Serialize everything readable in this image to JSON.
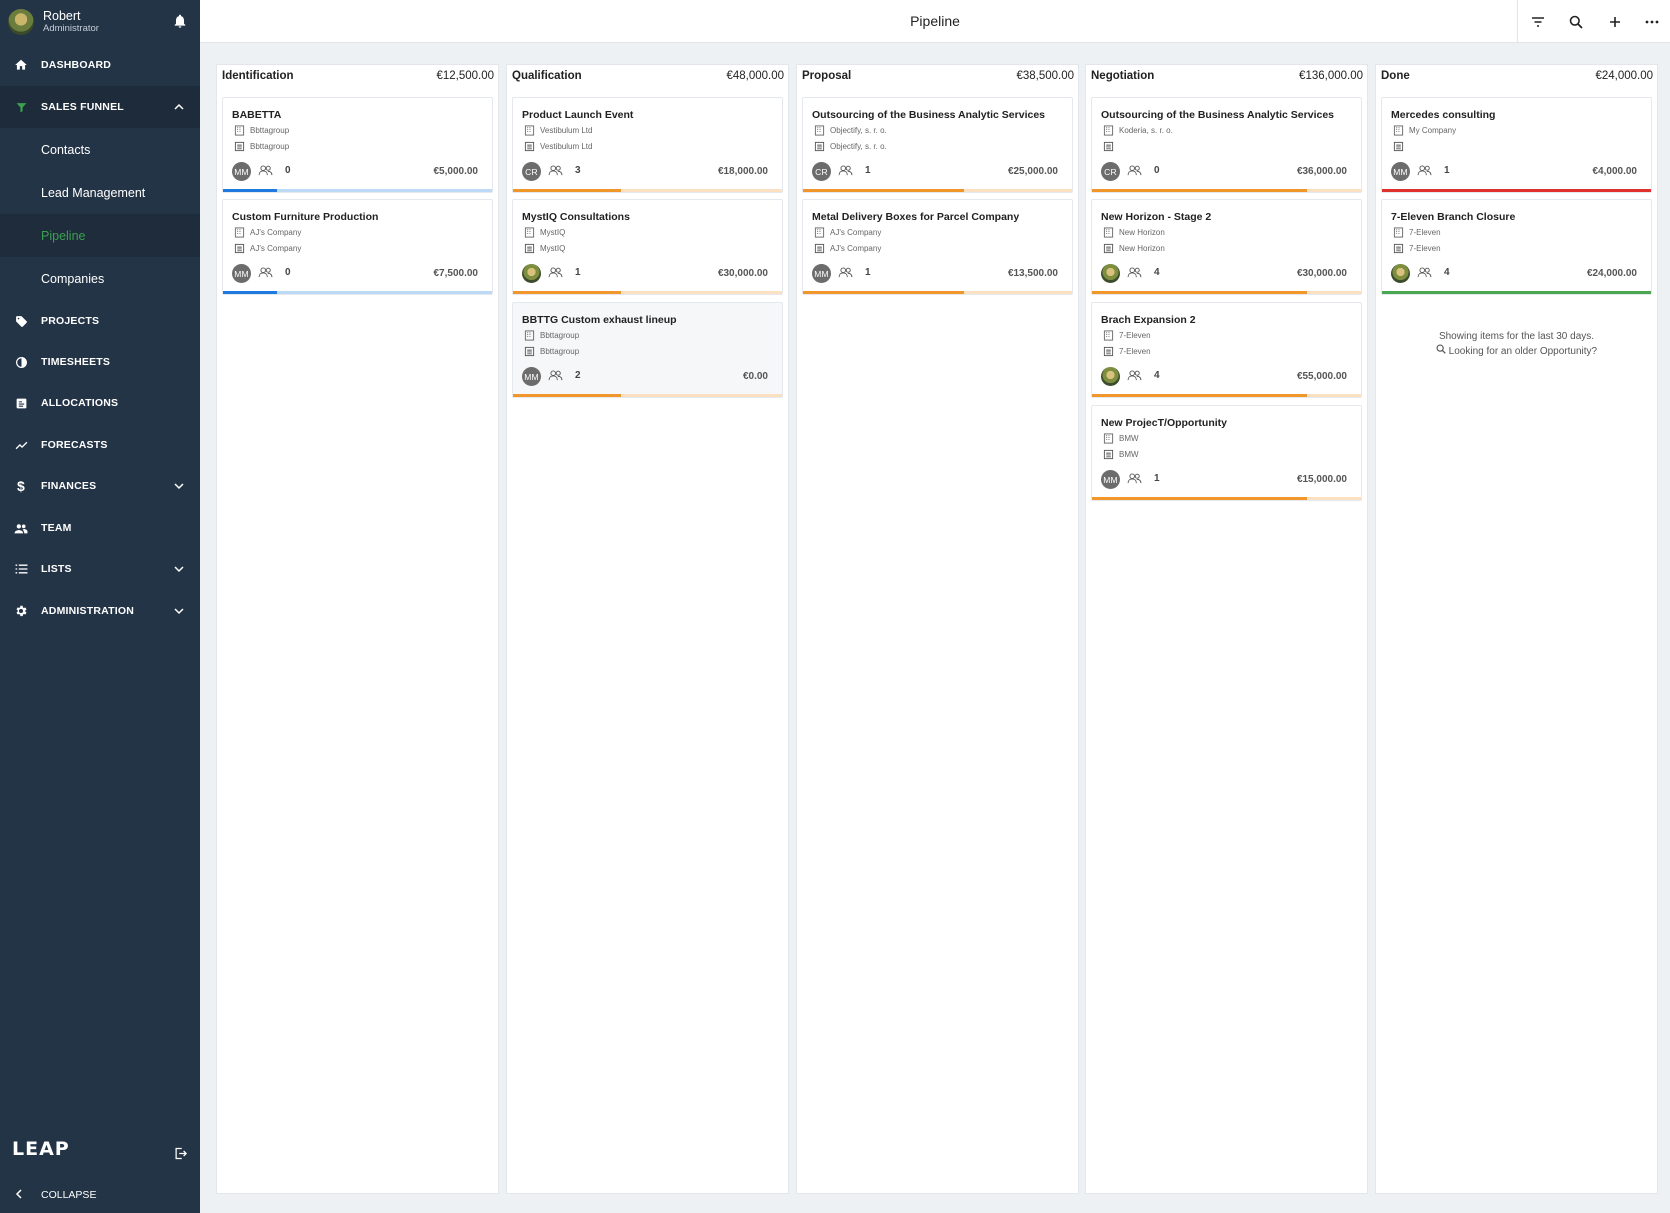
{
  "user": {
    "name": "Robert",
    "role": "Administrator"
  },
  "nav": {
    "dashboard": "DASHBOARD",
    "sales_funnel": "SALES FUNNEL",
    "sub": [
      "Contacts",
      "Lead Management",
      "Pipeline",
      "Companies"
    ],
    "projects": "PROJECTS",
    "timesheets": "TIMESHEETS",
    "allocations": "ALLOCATIONS",
    "forecasts": "FORECASTS",
    "finances": "FINANCES",
    "team": "TEAM",
    "lists": "LISTS",
    "administration": "ADMINISTRATION",
    "collapse": "COLLAPSE",
    "logo": "LEAP"
  },
  "page": {
    "title": "Pipeline"
  },
  "colors": {
    "blue": "#1f7ae0",
    "blue_light": "#bcd9f5",
    "orange": "#f0962a",
    "orange_light": "#fbe0c2",
    "red": "#e0322c",
    "green": "#49a651",
    "sidebar": "#243447",
    "accent": "#3aa14f"
  },
  "columns": [
    {
      "name": "Identification",
      "total": "€12,500.00",
      "cards": [
        {
          "title": "BABETTA",
          "company": "Bbttagroup",
          "account": "Bbttagroup",
          "avatar": "MM",
          "people": "0",
          "amount": "€5,000.00",
          "bar_color": "blue",
          "progress": 0.2
        },
        {
          "title": "Custom Furniture Production",
          "company": "AJ's Company",
          "account": "AJ's Company",
          "avatar": "MM",
          "people": "0",
          "amount": "€7,500.00",
          "bar_color": "blue",
          "progress": 0.2
        }
      ]
    },
    {
      "name": "Qualification",
      "total": "€48,000.00",
      "cards": [
        {
          "title": "Product Launch Event",
          "company": "Vestibulum Ltd",
          "account": "Vestibulum Ltd",
          "avatar": "CR",
          "people": "3",
          "amount": "€18,000.00",
          "bar_color": "orange",
          "progress": 0.4
        },
        {
          "title": "MystIQ Consultations",
          "company": "MystIQ",
          "account": "MystIQ",
          "avatar": "",
          "photo": true,
          "people": "1",
          "amount": "€30,000.00",
          "bar_color": "orange",
          "progress": 0.4
        },
        {
          "title": "BBTTG Custom exhaust lineup",
          "company": "Bbttagroup",
          "account": "Bbttagroup",
          "avatar": "MM",
          "people": "2",
          "amount": "€0.00",
          "bar_color": "orange",
          "progress": 0.4,
          "hover": true
        }
      ]
    },
    {
      "name": "Proposal",
      "total": "€38,500.00",
      "cards": [
        {
          "title": "Outsourcing of the Business Analytic Services",
          "company": "Objectify, s. r. o.",
          "account": "Objectify, s. r. o.",
          "avatar": "CR",
          "people": "1",
          "amount": "€25,000.00",
          "bar_color": "orange",
          "progress": 0.6
        },
        {
          "title": "Metal Delivery Boxes for Parcel Company",
          "company": "AJ's Company",
          "account": "AJ's Company",
          "avatar": "MM",
          "people": "1",
          "amount": "€13,500.00",
          "bar_color": "orange",
          "progress": 0.6
        }
      ]
    },
    {
      "name": "Negotiation",
      "total": "€136,000.00",
      "cards": [
        {
          "title": "Outsourcing of the Business Analytic Services",
          "company": "Koderia, s. r. o.",
          "account": "",
          "avatar": "CR",
          "people": "0",
          "amount": "€36,000.00",
          "bar_color": "orange",
          "progress": 0.8
        },
        {
          "title": "New Horizon - Stage 2",
          "company": "New Horizon",
          "account": "New Horizon",
          "avatar": "",
          "photo": true,
          "people": "4",
          "amount": "€30,000.00",
          "bar_color": "orange",
          "progress": 0.8
        },
        {
          "title": "Brach Expansion 2",
          "company": "7-Eleven",
          "account": "7-Eleven",
          "avatar": "",
          "photo": true,
          "people": "4",
          "amount": "€55,000.00",
          "bar_color": "orange",
          "progress": 0.8
        },
        {
          "title": "New ProjecT/Opportunity",
          "company": "BMW",
          "account": "BMW",
          "avatar": "MM",
          "people": "1",
          "amount": "€15,000.00",
          "bar_color": "orange",
          "progress": 0.8
        }
      ]
    },
    {
      "name": "Done",
      "total": "€24,000.00",
      "cards": [
        {
          "title": "Mercedes consulting",
          "company": "My Company",
          "account": "",
          "avatar": "MM",
          "people": "1",
          "amount": "€4,000.00",
          "bar_color": "red",
          "progress": 1.0
        },
        {
          "title": "7-Eleven Branch Closure",
          "company": "7-Eleven",
          "account": "7-Eleven",
          "avatar": "",
          "photo": true,
          "people": "4",
          "amount": "€24,000.00",
          "bar_color": "green",
          "progress": 1.0
        }
      ],
      "notice": "Showing items for the last 30 days.",
      "notice_link": "Looking for an older Opportunity?"
    }
  ]
}
